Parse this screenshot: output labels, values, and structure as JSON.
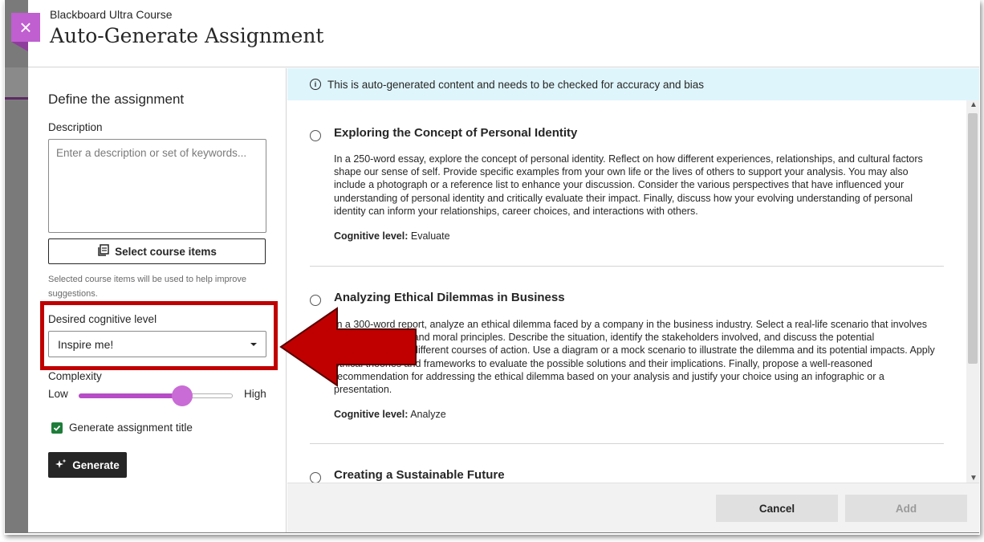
{
  "header": {
    "breadcrumb": "Blackboard Ultra Course",
    "title": "Auto-Generate Assignment"
  },
  "close_glyph": "×",
  "form": {
    "section_title": "Define the assignment",
    "description_label": "Description",
    "description_placeholder": "Enter a description or set of keywords...",
    "select_items_label": "Select course items",
    "helper_text": "Selected course items will be used to help improve suggestions.",
    "cognitive_label": "Desired cognitive level",
    "cognitive_value": "Inspire me!",
    "complexity_label": "Complexity",
    "complexity_low": "Low",
    "complexity_high": "High",
    "complexity_level": 0.67,
    "generate_title_label": "Generate assignment title",
    "generate_title_checked": true,
    "generate_label": "Generate"
  },
  "notice": {
    "text": "This is auto-generated content and needs to be checked for accuracy and bias"
  },
  "options": [
    {
      "title": "Exploring the Concept of Personal Identity",
      "body": "In a 250-word essay, explore the concept of personal identity. Reflect on how different experiences, relationships, and cultural factors shape our sense of self. Provide specific examples from your own life or the lives of others to support your analysis. You may also include a photograph or a reference list to enhance your discussion. Consider the various perspectives that have influenced your understanding of personal identity and critically evaluate their impact. Finally, discuss how your evolving understanding of personal identity can inform your relationships, career choices, and interactions with others.",
      "level_label": "Cognitive level:",
      "level_value": "Evaluate"
    },
    {
      "title": "Analyzing Ethical Dilemmas in Business",
      "body": "In a 300-word report, analyze an ethical dilemma faced by a company in the business industry. Select a real-life scenario that involves conflicting values and moral principles. Describe the situation, identify the stakeholders involved, and discuss the potential consequences of different courses of action. Use a diagram or a mock scenario to illustrate the dilemma and its potential impacts. Apply ethical theories and frameworks to evaluate the possible solutions and their implications. Finally, propose a well-reasoned recommendation for addressing the ethical dilemma based on your analysis and justify your choice using an infographic or a presentation.",
      "level_label": "Cognitive level:",
      "level_value": "Analyze"
    },
    {
      "title": "Creating a Sustainable Future"
    }
  ],
  "footer": {
    "cancel_label": "Cancel",
    "add_label": "Add"
  },
  "colors": {
    "accent_purple": "#c05fd0",
    "annotation_red": "#c00000",
    "notice_bg": "#def5fb",
    "checkbox_green": "#1e7d3a"
  }
}
